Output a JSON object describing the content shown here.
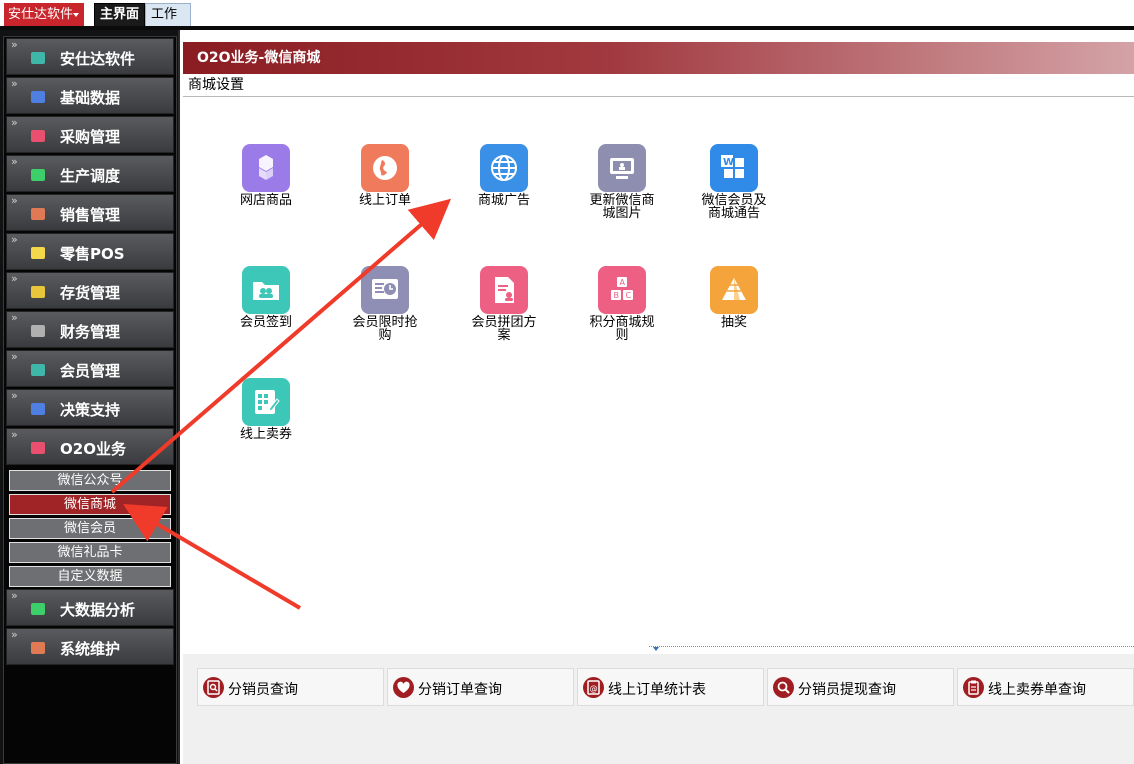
{
  "topbar": {
    "app_menu_label": "安仕达软件",
    "tabs": [
      {
        "label": "主界面"
      },
      {
        "label": "工作台"
      }
    ]
  },
  "sidebar": {
    "items": [
      {
        "label": "安仕达软件",
        "icon": "teal-cube-icon",
        "color": "#3fb7a8"
      },
      {
        "label": "基础数据",
        "icon": "blue-cube-icon",
        "color": "#4f7fe0"
      },
      {
        "label": "采购管理",
        "icon": "pink-cube-icon",
        "color": "#e9506f"
      },
      {
        "label": "生产调度",
        "icon": "green-cube-icon",
        "color": "#3ccf6a"
      },
      {
        "label": "销售管理",
        "icon": "orange-cube-icon",
        "color": "#e07a55"
      },
      {
        "label": "零售POS",
        "icon": "yellow-cube-icon",
        "color": "#f2d84a"
      },
      {
        "label": "存货管理",
        "icon": "gold-cube-icon",
        "color": "#e8c53a"
      },
      {
        "label": "财务管理",
        "icon": "gray-cube-icon",
        "color": "#b0b0b0"
      },
      {
        "label": "会员管理",
        "icon": "teal-cube-icon",
        "color": "#3fb7a8"
      },
      {
        "label": "决策支持",
        "icon": "blue-cube-icon",
        "color": "#4f7fe0"
      },
      {
        "label": "O2O业务",
        "icon": "pink-cube-icon",
        "color": "#e9506f"
      }
    ],
    "o2o_subitems": [
      {
        "label": "微信公众号"
      },
      {
        "label": "微信商城",
        "active": true
      },
      {
        "label": "微信会员"
      },
      {
        "label": "微信礼品卡"
      },
      {
        "label": "自定义数据"
      }
    ],
    "bottom_items": [
      {
        "label": "大数据分析",
        "icon": "green-cube-icon",
        "color": "#3ccf6a"
      },
      {
        "label": "系统维护",
        "icon": "orange-cube-icon",
        "color": "#e07a55"
      }
    ]
  },
  "main": {
    "title": "O2O业务-微信商城",
    "section": "商城设置",
    "tiles": [
      {
        "label": "网店商品",
        "icon": "cubes-icon",
        "color": "#9b7be8"
      },
      {
        "label": "线上订单",
        "icon": "globe-africa-icon",
        "color": "#ef7a5c"
      },
      {
        "label": "商城广告",
        "icon": "globe-grid-icon",
        "color": "#3a8fe6"
      },
      {
        "label": "更新微信商城图片",
        "icon": "monitor-icon",
        "color": "#8e8eb0"
      },
      {
        "label": "微信会员及商城通告",
        "icon": "word-apps-icon",
        "color": "#2f8ae8"
      },
      {
        "label": "会员签到",
        "icon": "folder-users-icon",
        "color": "#3cc7b8"
      },
      {
        "label": "会员限时抢购",
        "icon": "timer-board-icon",
        "color": "#8f8fb5"
      },
      {
        "label": "会员拼团方案",
        "icon": "document-person-icon",
        "color": "#ee5f84"
      },
      {
        "label": "积分商城规则",
        "icon": "abc-blocks-icon",
        "color": "#ee5f84"
      },
      {
        "label": "抽奖",
        "icon": "pyramid-icon",
        "color": "#f4a43b"
      },
      {
        "label": "线上卖券",
        "icon": "checklist-icon",
        "color": "#3cc7b8"
      }
    ]
  },
  "quick_links": [
    {
      "label": "分销员查询",
      "icon": "search-doc-icon"
    },
    {
      "label": "分销订单查询",
      "icon": "heart-icon"
    },
    {
      "label": "线上订单统计表",
      "icon": "at-doc-icon"
    },
    {
      "label": "分销员提现查询",
      "icon": "magnifier-icon"
    },
    {
      "label": "线上卖券单查询",
      "icon": "clipboard-icon"
    }
  ],
  "colors": {
    "accent_red": "#a02426",
    "header_red": "#8a1d22",
    "arrow_red": "#f03a2a"
  }
}
